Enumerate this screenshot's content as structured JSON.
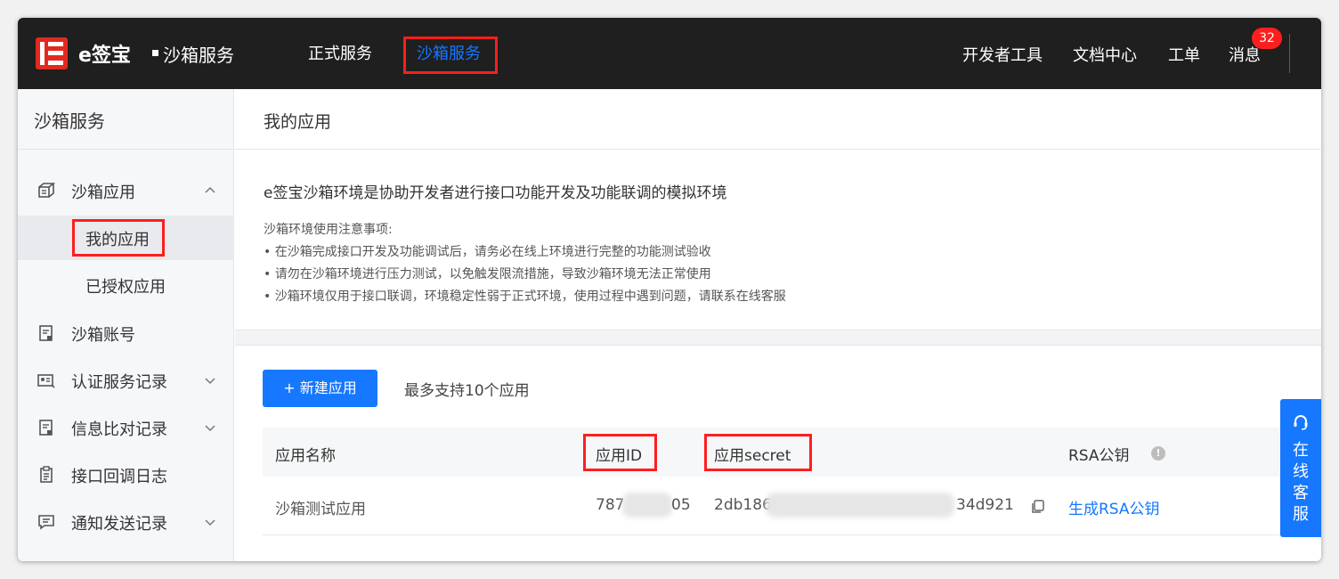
{
  "topbar": {
    "brand": "e签宝",
    "brand_sub": "沙箱服务",
    "tabs": [
      {
        "label": "正式服务",
        "active": false
      },
      {
        "label": "沙箱服务",
        "active": true
      }
    ],
    "right_items": [
      "开发者工具",
      "文档中心",
      "工单",
      "消息"
    ],
    "message_badge": "32"
  },
  "sidebar": {
    "title": "沙箱服务",
    "items": [
      {
        "label": "沙箱应用",
        "icon": "cube-icon",
        "chevron": "chevron-up-icon"
      },
      {
        "label": "我的应用"
      },
      {
        "label": "已授权应用"
      },
      {
        "label": "沙箱账号",
        "icon": "account-doc-icon"
      },
      {
        "label": "认证服务记录",
        "icon": "id-card-icon",
        "chevron": "chevron-down-icon"
      },
      {
        "label": "信息比对记录",
        "icon": "compare-doc-icon",
        "chevron": "chevron-down-icon"
      },
      {
        "label": "接口回调日志",
        "icon": "log-icon"
      },
      {
        "label": "通知发送记录",
        "icon": "message-icon",
        "chevron": "chevron-down-icon"
      }
    ]
  },
  "main": {
    "page_title": "我的应用",
    "intro_heading": "e签宝沙箱环境是协助开发者进行接口功能开发及功能联调的模拟环境",
    "notes_heading": "沙箱环境使用注意事项:",
    "notes": [
      "• 在沙箱完成接口开发及功能调试后，请务必在线上环境进行完整的功能测试验收",
      "• 请勿在沙箱环境进行压力测试，以免触发限流措施，导致沙箱环境无法正常使用",
      "• 沙箱环境仅用于接口联调，环境稳定性弱于正式环境，使用过程中遇到问题，请联系在线客服"
    ],
    "new_app_button": "+ 新建应用",
    "max_apps_note": "最多支持10个应用",
    "table": {
      "headers": [
        "应用名称",
        "应用ID",
        "应用secret",
        "RSA公钥"
      ],
      "rows": [
        {
          "name": "沙箱测试应用",
          "app_id_start": "787",
          "app_id_end": "05",
          "secret_start": "2db186",
          "secret_end": "34d921",
          "rsa_action": "生成RSA公钥"
        }
      ]
    }
  },
  "service_tab": {
    "chars": [
      "在",
      "线",
      "客",
      "服"
    ]
  },
  "colors": {
    "topbar_bg": "#1f1f1f",
    "accent": "#1677ff",
    "highlight_border": "#ff1e1e",
    "logo_red": "#e12a1f"
  }
}
